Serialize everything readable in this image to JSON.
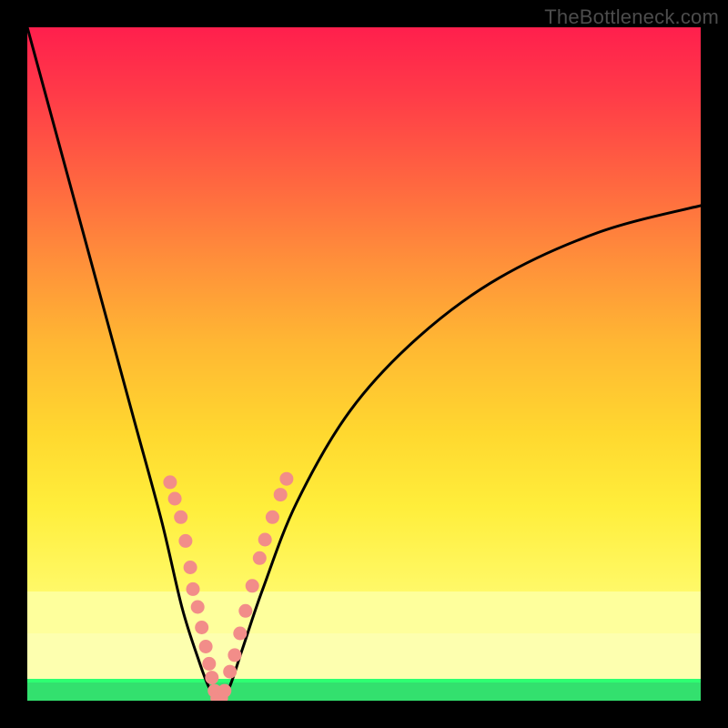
{
  "watermark": {
    "text": "TheBottleneck.com"
  },
  "chart_data": {
    "type": "line",
    "title": "",
    "xlabel": "",
    "ylabel": "",
    "xlim": [
      0,
      100
    ],
    "ylim": [
      -2,
      100
    ],
    "grid": false,
    "background": {
      "type": "vertical-gradient",
      "red_to_yellow_stops": [
        {
          "pct": 0,
          "color": "#ff1f4d"
        },
        {
          "pct": 50,
          "color": "#ffb030"
        },
        {
          "pct": 80,
          "color": "#fff050"
        }
      ],
      "bottom_bands": [
        {
          "from_pct": 84,
          "to_pct": 90,
          "color": "#feff9c"
        },
        {
          "from_pct": 90,
          "to_pct": 97,
          "color": "#fdffaf"
        },
        {
          "from_pct": 97,
          "to_pct": 97.5,
          "color": "#2dff72"
        },
        {
          "from_pct": 97.5,
          "to_pct": 100,
          "color": "#33e06e"
        }
      ]
    },
    "series": [
      {
        "name": "left-descending-curve",
        "stroke": "#000",
        "x": [
          0,
          4,
          8,
          12,
          16,
          20,
          23,
          25.5,
          27,
          28.5
        ],
        "y": [
          100,
          85,
          70,
          55,
          40,
          25,
          12,
          4,
          0,
          -2
        ]
      },
      {
        "name": "right-ascending-curve",
        "stroke": "#000",
        "x": [
          28.5,
          30,
          32,
          35,
          40,
          48,
          58,
          70,
          85,
          100
        ],
        "y": [
          -2,
          0,
          6,
          15,
          28,
          42,
          53,
          62,
          69,
          73
        ]
      }
    ],
    "markers": [
      {
        "name": "left-branch-dots",
        "color": "#f28d89",
        "points": [
          {
            "x": 21.2,
            "y": 31.1
          },
          {
            "x": 21.9,
            "y": 28.6
          },
          {
            "x": 22.8,
            "y": 25.8
          },
          {
            "x": 23.5,
            "y": 22.2
          },
          {
            "x": 24.2,
            "y": 18.2
          },
          {
            "x": 24.6,
            "y": 14.9
          },
          {
            "x": 25.3,
            "y": 12.2
          },
          {
            "x": 25.9,
            "y": 9.1
          },
          {
            "x": 26.5,
            "y": 6.2
          },
          {
            "x": 27.0,
            "y": 3.6
          },
          {
            "x": 27.4,
            "y": 1.5
          }
        ]
      },
      {
        "name": "right-branch-dots",
        "color": "#f28d89",
        "points": [
          {
            "x": 30.1,
            "y": 2.4
          },
          {
            "x": 30.8,
            "y": 4.9
          },
          {
            "x": 31.6,
            "y": 8.2
          },
          {
            "x": 32.4,
            "y": 11.6
          },
          {
            "x": 33.4,
            "y": 15.4
          },
          {
            "x": 34.5,
            "y": 19.6
          },
          {
            "x": 35.3,
            "y": 22.4
          },
          {
            "x": 36.4,
            "y": 25.8
          },
          {
            "x": 37.6,
            "y": 29.2
          },
          {
            "x": 38.5,
            "y": 31.6
          }
        ]
      },
      {
        "name": "trough-dots",
        "color": "#f28d89",
        "points": [
          {
            "x": 27.8,
            "y": -0.5
          },
          {
            "x": 28.2,
            "y": -1.6
          },
          {
            "x": 28.8,
            "y": -1.6
          },
          {
            "x": 29.3,
            "y": -0.5
          }
        ]
      }
    ]
  }
}
